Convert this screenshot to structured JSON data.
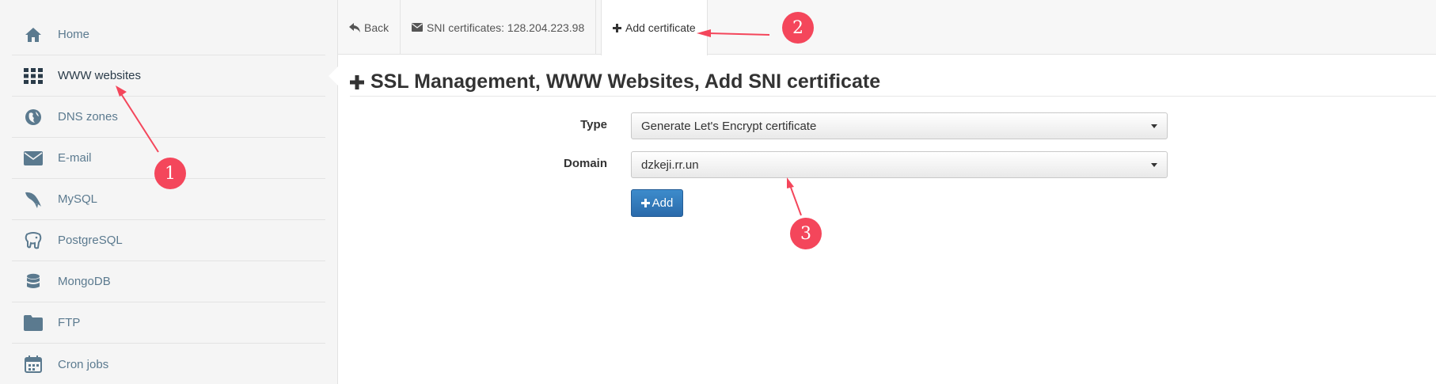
{
  "sidebar": {
    "items": [
      {
        "label": "Home",
        "icon": "home-icon"
      },
      {
        "label": "WWW websites",
        "icon": "grid-icon",
        "active": true
      },
      {
        "label": "DNS zones",
        "icon": "globe-icon"
      },
      {
        "label": "E-mail",
        "icon": "envelope-icon"
      },
      {
        "label": "MySQL",
        "icon": "dolphin-icon"
      },
      {
        "label": "PostgreSQL",
        "icon": "elephant-icon"
      },
      {
        "label": "MongoDB",
        "icon": "database-icon"
      },
      {
        "label": "FTP",
        "icon": "folder-icon"
      },
      {
        "label": "Cron jobs",
        "icon": "calendar-icon"
      }
    ]
  },
  "tabs": {
    "back": "Back",
    "sni_certificates": "SNI certificates: 128.204.223.98",
    "add_certificate": "Add certificate"
  },
  "page": {
    "title": "SSL Management, WWW Websites, Add SNI certificate"
  },
  "form": {
    "type_label": "Type",
    "type_value": "Generate Let's Encrypt certificate",
    "domain_label": "Domain",
    "domain_value": "dzkeji.rr.un",
    "add_button": "Add"
  },
  "annotations": {
    "badge1": "1",
    "badge2": "2",
    "badge3": "3",
    "color": "#f4465b"
  },
  "colors": {
    "sidebar_bg": "#f5f5f5",
    "nav_text": "#5b7a8f",
    "button_blue": "#2a6aab"
  }
}
